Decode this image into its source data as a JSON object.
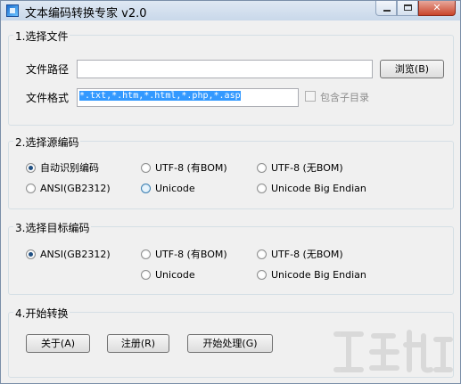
{
  "window": {
    "title": "文本编码转换专家 v2.0",
    "controls": {
      "minimize_icon": "minimize-icon",
      "maximize_icon": "maximize-icon",
      "close_label": "✕"
    }
  },
  "file_group": {
    "title": "1.选择文件",
    "path_label": "文件路径",
    "path_value": "",
    "browse_button": "浏览(B)",
    "format_label": "文件格式",
    "format_value": "*.txt,*.htm,*.html,*.php,*.asp",
    "include_subdirs_label": "包含子目录",
    "include_subdirs_checked": false
  },
  "source_group": {
    "title": "2.选择源编码",
    "options": [
      {
        "label": "自动识别编码",
        "checked": true
      },
      {
        "label": "UTF-8 (有BOM)",
        "checked": false
      },
      {
        "label": "UTF-8 (无BOM)",
        "checked": false
      },
      {
        "label": "ANSI(GB2312)",
        "checked": false
      },
      {
        "label": "Unicode",
        "checked": false
      },
      {
        "label": "Unicode Big Endian",
        "checked": false
      }
    ]
  },
  "target_group": {
    "title": "3.选择目标编码",
    "options": [
      {
        "label": "ANSI(GB2312)",
        "checked": true
      },
      {
        "label": "UTF-8 (有BOM)",
        "checked": false
      },
      {
        "label": "UTF-8 (无BOM)",
        "checked": false
      },
      {
        "label": "Unicode",
        "checked": false
      },
      {
        "label": "Unicode Big Endian",
        "checked": false
      }
    ]
  },
  "start_group": {
    "title": "4.开始转换",
    "about_button": "关于(A)",
    "register_button": "注册(R)",
    "start_button": "开始处理(G)"
  },
  "colors": {
    "selection": "#3399ff",
    "title_gradient_top": "#dfe8f3",
    "close_button": "#c9442a"
  }
}
